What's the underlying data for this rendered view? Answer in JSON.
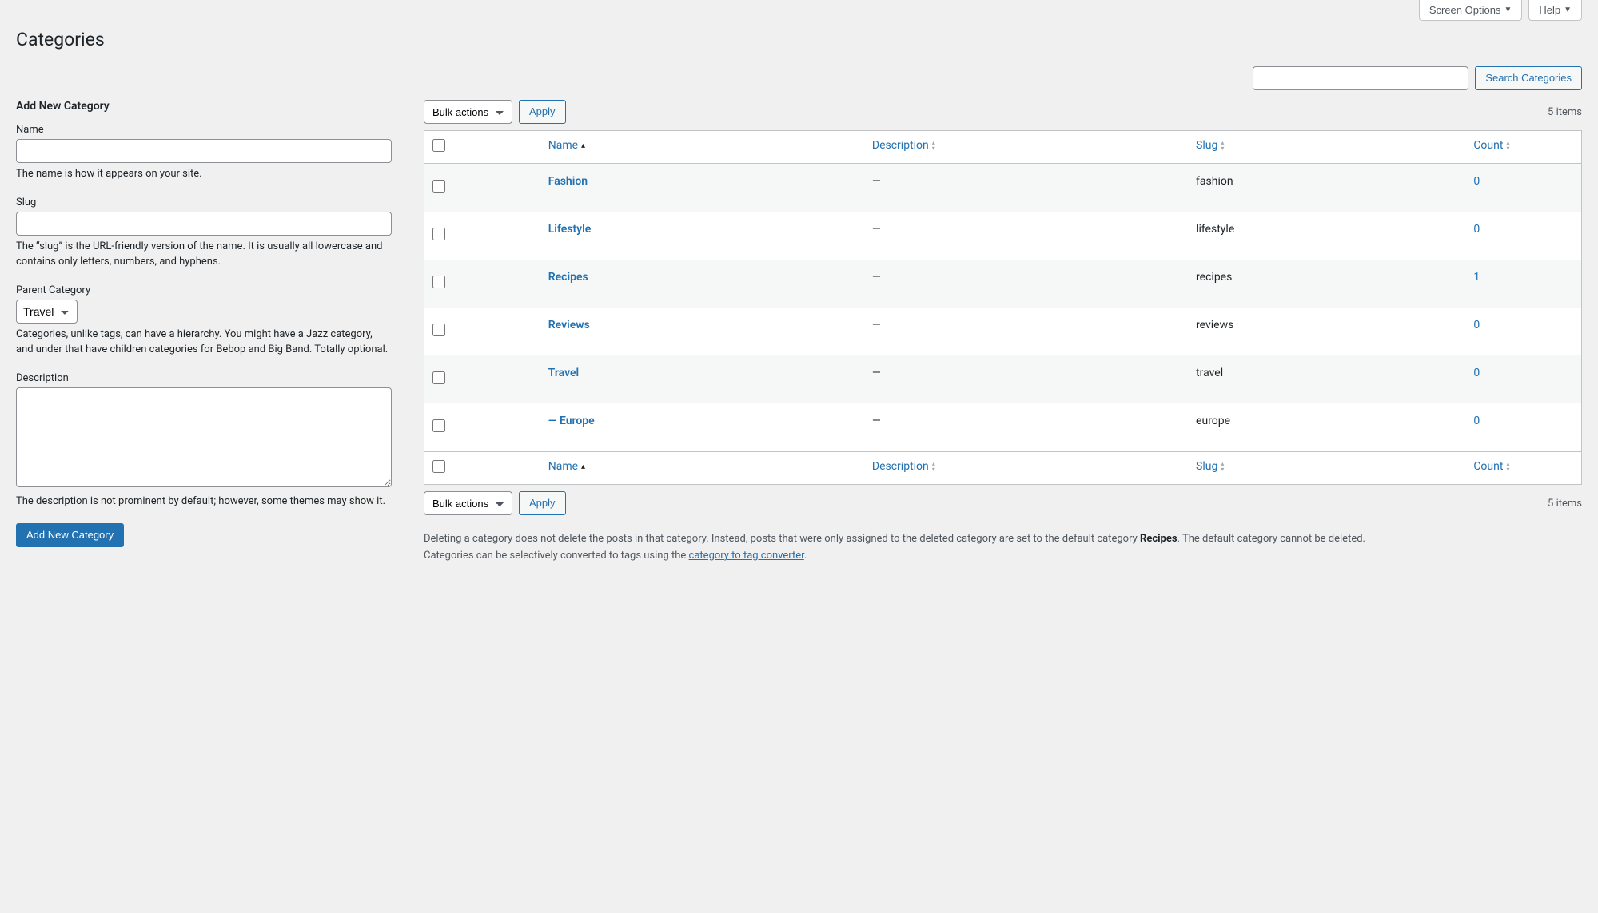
{
  "screen_meta": {
    "options": "Screen Options",
    "help": "Help"
  },
  "page_title": "Categories",
  "search": {
    "button": "Search Categories",
    "value": ""
  },
  "form": {
    "heading": "Add New Category",
    "name": {
      "label": "Name",
      "value": "",
      "help": "The name is how it appears on your site."
    },
    "slug": {
      "label": "Slug",
      "value": "",
      "help": "The “slug” is the URL-friendly version of the name. It is usually all lowercase and contains only letters, numbers, and hyphens."
    },
    "parent": {
      "label": "Parent Category",
      "selected": "Travel",
      "help": "Categories, unlike tags, can have a hierarchy. You might have a Jazz category, and under that have children categories for Bebop and Big Band. Totally optional."
    },
    "description": {
      "label": "Description",
      "value": "",
      "help": "The description is not prominent by default; however, some themes may show it."
    },
    "submit": "Add New Category"
  },
  "bulk": {
    "selected": "Bulk actions",
    "apply": "Apply"
  },
  "items_count": "5 items",
  "columns": {
    "name": "Name",
    "description": "Description",
    "slug": "Slug",
    "count": "Count"
  },
  "rows": [
    {
      "name": "Fashion",
      "description": "—",
      "slug": "fashion",
      "count": "0",
      "indent": false
    },
    {
      "name": "Lifestyle",
      "description": "—",
      "slug": "lifestyle",
      "count": "0",
      "indent": false
    },
    {
      "name": "Recipes",
      "description": "—",
      "slug": "recipes",
      "count": "1",
      "indent": false
    },
    {
      "name": "Reviews",
      "description": "—",
      "slug": "reviews",
      "count": "0",
      "indent": false
    },
    {
      "name": "Travel",
      "description": "—",
      "slug": "travel",
      "count": "0",
      "indent": false
    },
    {
      "name": "— Europe",
      "description": "—",
      "slug": "europe",
      "count": "0",
      "indent": false
    }
  ],
  "notes": {
    "delete_part1": "Deleting a category does not delete the posts in that category. Instead, posts that were only assigned to the deleted category are set to the default category ",
    "default_cat": "Recipes",
    "delete_part2": ". The default category cannot be deleted.",
    "convert_part1": "Categories can be selectively converted to tags using the ",
    "convert_link": "category to tag converter",
    "convert_part2": "."
  }
}
